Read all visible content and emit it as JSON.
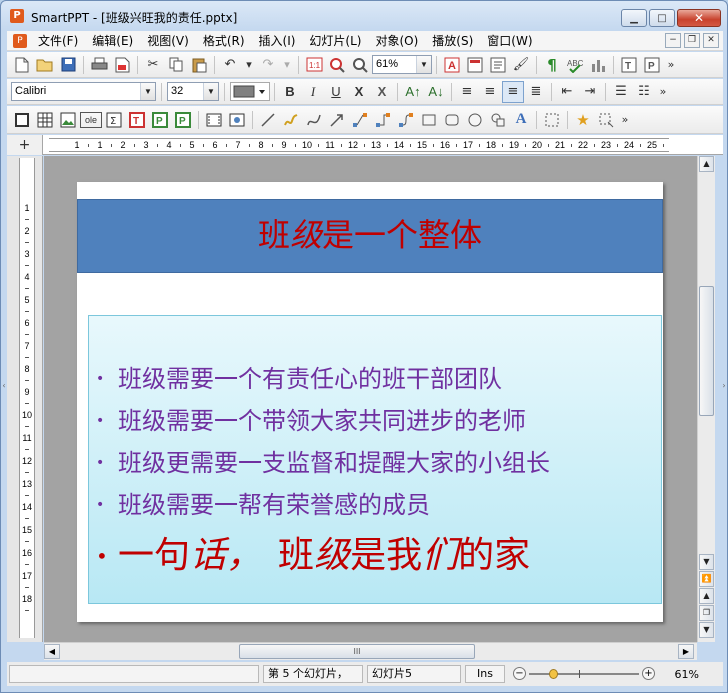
{
  "app": {
    "title": "SmartPPT - [班级兴旺我的责任.pptx]",
    "icon_letter": "P"
  },
  "window_controls": {
    "minimize": "▁",
    "maximize": "□",
    "close": "✕"
  },
  "mdi_controls": {
    "minimize": "−",
    "restore": "❐",
    "close": "✕"
  },
  "menu": [
    "文件(F)",
    "编辑(E)",
    "视图(V)",
    "格式(R)",
    "插入(I)",
    "幻灯片(L)",
    "对象(O)",
    "播放(S)",
    "窗口(W)"
  ],
  "toolbar1": {
    "zoom_value": "61%"
  },
  "toolbar2": {
    "font_name": "Calibri",
    "font_size": "32"
  },
  "ruler": {
    "h_ticks": [
      "1",
      "1",
      "2",
      "3",
      "4",
      "5",
      "6",
      "7",
      "8",
      "9",
      "10",
      "11",
      "12",
      "13",
      "14",
      "15",
      "16",
      "17",
      "18",
      "19",
      "20",
      "21",
      "22",
      "23",
      "24",
      "25"
    ],
    "v_ticks": [
      "1",
      "2",
      "3",
      "4",
      "5",
      "6",
      "7",
      "8",
      "9",
      "10",
      "11",
      "12",
      "13",
      "14",
      "15",
      "16",
      "17",
      "18"
    ]
  },
  "slide": {
    "title_parts": [
      {
        "text": "班",
        "italic": false
      },
      {
        "text": "级",
        "italic": true
      },
      {
        "text": "是一个整体",
        "italic": false
      }
    ],
    "bullets": [
      "班级需要一个有责任心的班干部团队",
      "班级需要一个带领大家共同进步的老师",
      "班级更需要一支监督和提醒大家的小组长",
      "班级需要一帮有荣誉感的成员"
    ],
    "big_bullet_parts": [
      {
        "text": "一句",
        "italic": false
      },
      {
        "text": "话，",
        "italic": true
      },
      {
        "text": "班",
        "italic": false
      },
      {
        "text": "级",
        "italic": true
      },
      {
        "text": "是我",
        "italic": false
      },
      {
        "text": "们",
        "italic": true
      },
      {
        "text": "的家",
        "italic": false
      }
    ],
    "bullet_symbol": "•",
    "colors": {
      "title": "#c00000",
      "title_bg": "#4f81bd",
      "bullet_text": "#7030a0",
      "big_bullet": "#c00000"
    }
  },
  "scroll": {
    "hthumb_grip": "III"
  },
  "status": {
    "slide_info": "第 5 个幻灯片，",
    "slide_name": "幻灯片5",
    "mode": "Ins",
    "zoom": "61%"
  }
}
